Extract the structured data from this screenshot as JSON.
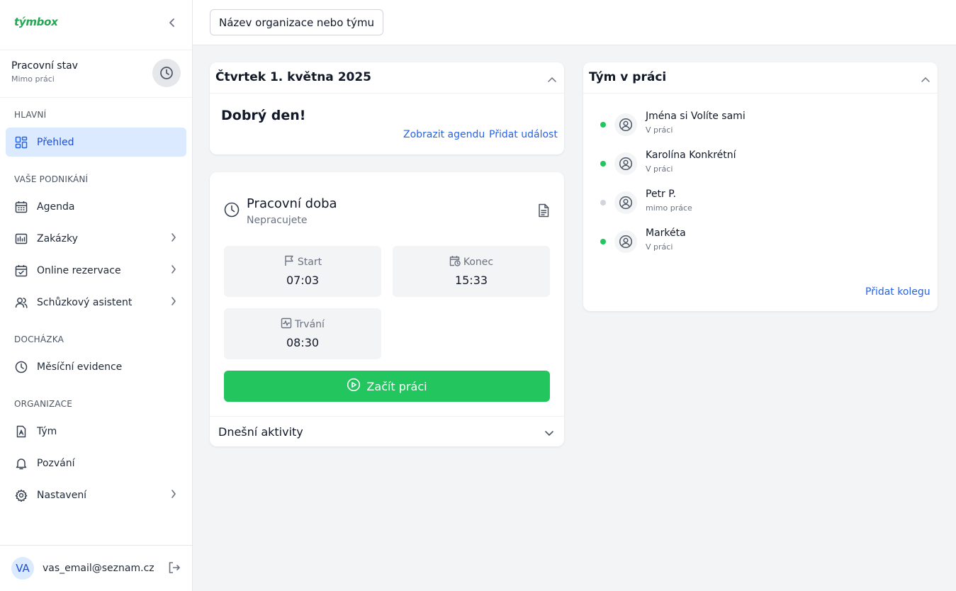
{
  "app": {
    "logo": "týmbox"
  },
  "status": {
    "title": "Pracovní stav",
    "subtitle": "Mimo práci"
  },
  "sections": {
    "main": "HLAVNÍ",
    "business": "VAŠE PODNIKÁNÍ",
    "attendance": "DOCHÁZKA",
    "organization": "ORGANIZACE"
  },
  "nav": {
    "overview": "Přehled",
    "agenda": "Agenda",
    "orders": "Zakázky",
    "booking": "Online rezervace",
    "meeting": "Schůzkový asistent",
    "monthly": "Měsíční evidence",
    "team": "Tým",
    "invites": "Pozvání",
    "settings": "Nastavení"
  },
  "user": {
    "initials": "VA",
    "email": "vas_email@seznam.cz"
  },
  "topbar": {
    "org_button": "Název organizace nebo týmu"
  },
  "day_card": {
    "date": "Čtvrtek 1. května 2025",
    "greeting": "Dobrý den!",
    "show_agenda": "Zobrazit agendu",
    "add_event": "Přidat událost"
  },
  "work_card": {
    "title": "Pracovní doba",
    "subtitle": "Nepracujete",
    "start_label": "Start",
    "start_value": "07:03",
    "end_label": "Konec",
    "end_value": "15:33",
    "duration_label": "Trvání",
    "duration_value": "08:30",
    "start_button": "Začít práci",
    "activities": "Dnešní aktivity"
  },
  "team_card": {
    "title": "Tým v práci",
    "members": [
      {
        "name": "Jména si Volíte sami",
        "status": "V práci",
        "online": true
      },
      {
        "name": "Karolína Konkrétní",
        "status": "V práci",
        "online": true
      },
      {
        "name": "Petr P.",
        "status": "mimo práce",
        "online": false
      },
      {
        "name": "Markéta",
        "status": "V práci",
        "online": true
      }
    ],
    "add_colleague": "Přidat kolegu"
  },
  "colors": {
    "accent": "#2563eb",
    "success": "#22c55e",
    "offline": "#d1d5db",
    "active_bg": "#dbeafe"
  }
}
